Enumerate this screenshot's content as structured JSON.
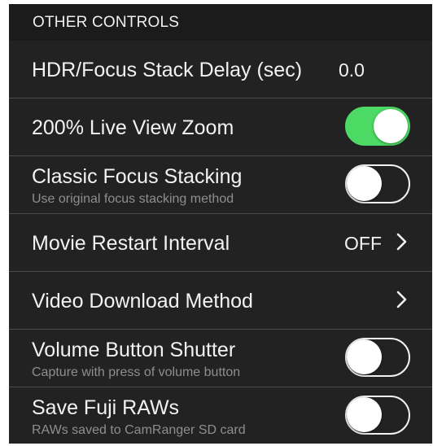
{
  "section": {
    "header": "OTHER CONTROLS"
  },
  "rows": [
    {
      "title": "HDR/Focus Stack Delay (sec)",
      "value": "0.0"
    },
    {
      "title": "200% Live View Zoom",
      "toggle": "on"
    },
    {
      "title": "Classic Focus Stacking",
      "subtitle": "Use original focus stacking method",
      "toggle": "off"
    },
    {
      "title": "Movie Restart Interval",
      "value": "OFF"
    },
    {
      "title": "Video Download Method"
    },
    {
      "title": "Volume Button Shutter",
      "subtitle": "Capture with press of volume button",
      "toggle": "off"
    },
    {
      "title": "Save Fuji RAWs",
      "subtitle": "RAWs saved to CamRanger SD card",
      "toggle": "off"
    }
  ],
  "colors": {
    "background": "#222223",
    "header_background": "#1b1b1c",
    "separator": "#4a4a4c",
    "toggle_on": "#4cd964",
    "subtitle": "#8e8e91"
  },
  "icons": {
    "disclosure": "chevron-right-icon"
  }
}
